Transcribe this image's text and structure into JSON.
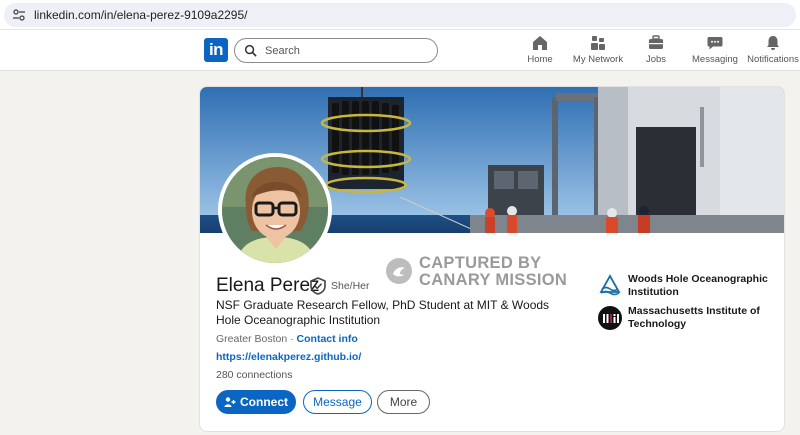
{
  "browser": {
    "url": "linkedin.com/in/elena-perez-9109a2295/"
  },
  "nav": {
    "logo": "in",
    "search_placeholder": "Search",
    "items": [
      {
        "label": "Home",
        "icon": "home-icon"
      },
      {
        "label": "My Network",
        "icon": "network-icon"
      },
      {
        "label": "Jobs",
        "icon": "briefcase-icon"
      },
      {
        "label": "Messaging",
        "icon": "message-icon"
      },
      {
        "label": "Notifications",
        "icon": "bell-icon"
      }
    ]
  },
  "profile": {
    "name": "Elena Perez",
    "pronouns": "She/Her",
    "headline": "NSF Graduate Research Fellow, PhD Student at MIT & Woods Hole Oceanographic Institution",
    "location": "Greater Boston",
    "location_separator": " · ",
    "contact_info": "Contact info",
    "website": "https://elenakperez.github.io/",
    "connections": "280 connections",
    "buttons": {
      "connect": "Connect",
      "message": "Message",
      "more": "More"
    },
    "watermark": {
      "line1": "CAPTURED BY",
      "line2": "CANARY MISSION"
    },
    "organizations": [
      {
        "name": "Woods Hole Oceanographic Institution",
        "icon": "whoi-logo-icon"
      },
      {
        "name": "Massachusetts Institute of Technology",
        "icon": "mit-logo-icon"
      }
    ]
  },
  "colors": {
    "brand": "#0a66c2",
    "page_bg": "#f4f2ee"
  }
}
